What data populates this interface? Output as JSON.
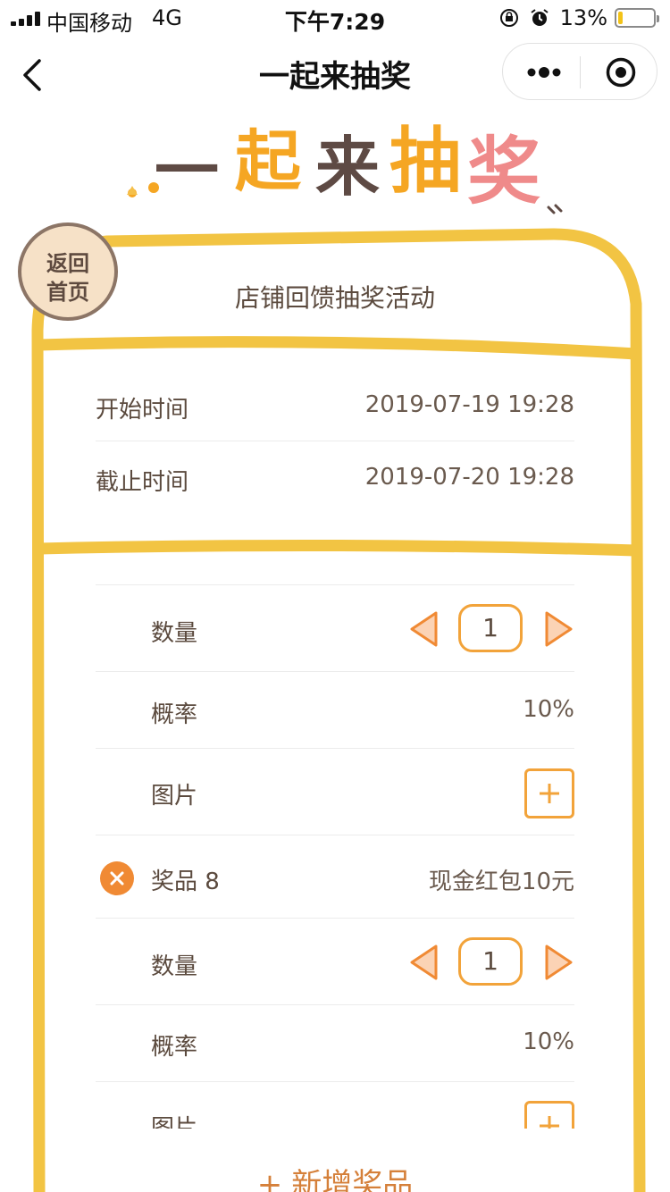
{
  "status": {
    "carrier": "中国移动",
    "network": "4G",
    "time": "下午7:29",
    "battery_percent": "13%",
    "battery_level": 0.13
  },
  "nav": {
    "title": "一起来抽奖",
    "back_icon": "chevron-left-icon",
    "more_icon": "more-dots-icon",
    "close_icon": "target-close-icon"
  },
  "banner": {
    "text_chars": [
      "一",
      "起",
      "来",
      "抽",
      "奖"
    ],
    "colors": [
      "#5e4a44",
      "#f5a623",
      "#5e4a44",
      "#f5a623",
      "#ef8a8a"
    ]
  },
  "back_home": {
    "line1": "返回",
    "line2": "首页"
  },
  "activity": {
    "title": "店铺回馈抽奖活动",
    "start_label": "开始时间",
    "start_value": "2019-07-19 19:28",
    "end_label": "截止时间",
    "end_value": "2019-07-20 19:28"
  },
  "prize_fields": {
    "quantity_label": "数量",
    "probability_label": "概率",
    "image_label": "图片"
  },
  "prizes": [
    {
      "quantity": "1",
      "probability": "10%"
    },
    {
      "name": "奖品 8",
      "value": "现金红包10元",
      "quantity": "1",
      "probability": "10%"
    }
  ],
  "add_prize": {
    "plus": "+",
    "label": "新增奖品"
  },
  "colors": {
    "frame_yellow": "#f2c443",
    "accent_orange": "#f2a33a",
    "delete_orange": "#f08a34",
    "text_brown": "#5b4a3e"
  }
}
